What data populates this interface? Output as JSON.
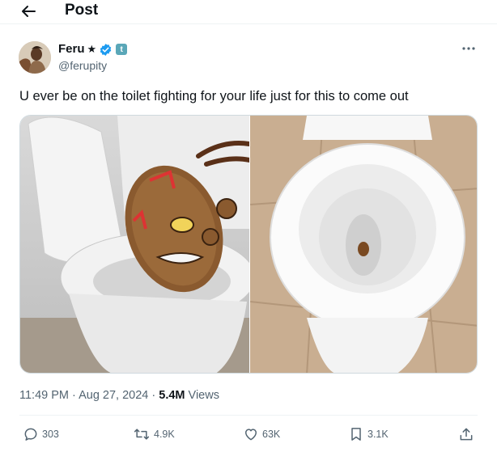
{
  "header": {
    "title": "Post",
    "back_icon": "arrow-left-icon"
  },
  "author": {
    "display_name": "Feru",
    "star": "★",
    "handle": "@ferupity",
    "verified_color": "#1d9bf0",
    "affiliate_badge": "t"
  },
  "tweet": {
    "text": "U ever be on the toilet fighting for your life just for this to come out"
  },
  "meta": {
    "time": "11:49 PM",
    "dot1": " · ",
    "date": "Aug 27, 2024",
    "dot2": " · ",
    "views_count": "5.4M",
    "views_label": " Views"
  },
  "actions": {
    "replies": "303",
    "reposts": "4.9K",
    "likes": "63K",
    "bookmarks": "3.1K"
  },
  "colors": {
    "text_primary": "#0f1419",
    "text_secondary": "#536471",
    "border": "#eff3f4",
    "accent": "#1d9bf0"
  }
}
